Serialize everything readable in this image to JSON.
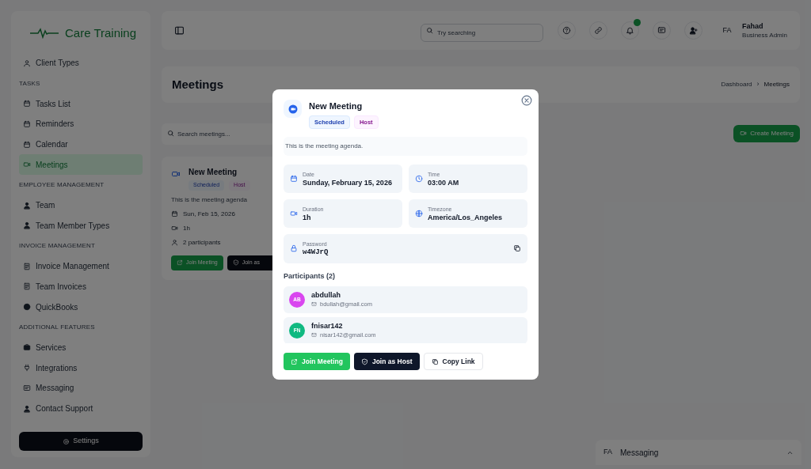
{
  "sidebar": {
    "brand": "Care Training",
    "sections": [
      {
        "items": [
          {
            "label": "Client Types",
            "selected": false
          }
        ]
      },
      {
        "heading": "TASKS",
        "items": [
          {
            "label": "Tasks List",
            "selected": false
          },
          {
            "label": "Reminders",
            "selected": false
          },
          {
            "label": "Calendar",
            "selected": false
          },
          {
            "label": "Meetings",
            "selected": true
          }
        ]
      },
      {
        "heading": "EMPLOYEE MANAGEMENT",
        "items": [
          {
            "label": "Team",
            "selected": false
          },
          {
            "label": "Team Member Types",
            "selected": false
          }
        ]
      },
      {
        "heading": "INVOICE MANAGEMENT",
        "items": [
          {
            "label": "Invoice Management",
            "selected": false
          },
          {
            "label": "Team Invoices",
            "selected": false
          },
          {
            "label": "QuickBooks",
            "selected": false
          }
        ]
      },
      {
        "heading": "ADDITIONAL FEATURES",
        "items": [
          {
            "label": "Services",
            "selected": false
          },
          {
            "label": "Integrations",
            "selected": false
          },
          {
            "label": "Messaging",
            "selected": false
          },
          {
            "label": "Contact Support",
            "selected": false
          }
        ]
      }
    ],
    "settings_button": "Settings"
  },
  "top_bar": {
    "search": {
      "placeholder": "Try searching"
    },
    "notification_badge": true,
    "user": {
      "initials": "FA",
      "name": "Fahad",
      "role": "Business Admin"
    }
  },
  "page_header": {
    "title": "Meetings",
    "breadcrumb": [
      "Dashboard",
      "Meetings"
    ],
    "separator": "›"
  },
  "toolbar": {
    "search": {
      "placeholder": "Search meetings..."
    },
    "create_button": "Create Meeting"
  },
  "meeting_card": {
    "title": "New Meeting",
    "badges": [
      "Scheduled",
      "Host"
    ],
    "agenda": "This is the meeting agenda",
    "date": "Sun, Feb 15, 2026",
    "duration": "1h",
    "participants": "2 participants",
    "buttons": [
      "Join Meeting",
      "Join as"
    ]
  },
  "modal": {
    "title": "New Meeting",
    "badges": [
      {
        "label": "Scheduled",
        "kind": "status"
      },
      {
        "label": "Host",
        "kind": "role"
      }
    ],
    "agenda": "This is the meeting agenda.",
    "details": [
      {
        "label": "Date",
        "value": "Sunday, February 15, 2026"
      },
      {
        "label": "Time",
        "value": "03:00 AM"
      },
      {
        "label": "Duration",
        "value": "1h"
      },
      {
        "label": "Timezone",
        "value": "America/Los_Angeles"
      }
    ],
    "password": {
      "label": "Password",
      "value": "w4WJrQ"
    },
    "participants_heading": "Participants (2)",
    "participants": [
      {
        "initials": "AB",
        "name": "abdullah",
        "email": "bdullah@gmail.com",
        "color": "#d946ef"
      },
      {
        "initials": "FN",
        "name": "fnisar142",
        "email": "nisar142@gmail.com",
        "color": "#10b981"
      }
    ],
    "buttons": [
      {
        "label": "Join Meeting",
        "kind": "primary"
      },
      {
        "label": "Join as Host",
        "kind": "dark"
      },
      {
        "label": "Copy Link",
        "kind": "outline"
      }
    ]
  },
  "chat_bar": {
    "initials": "FA",
    "title": "Messaging"
  }
}
